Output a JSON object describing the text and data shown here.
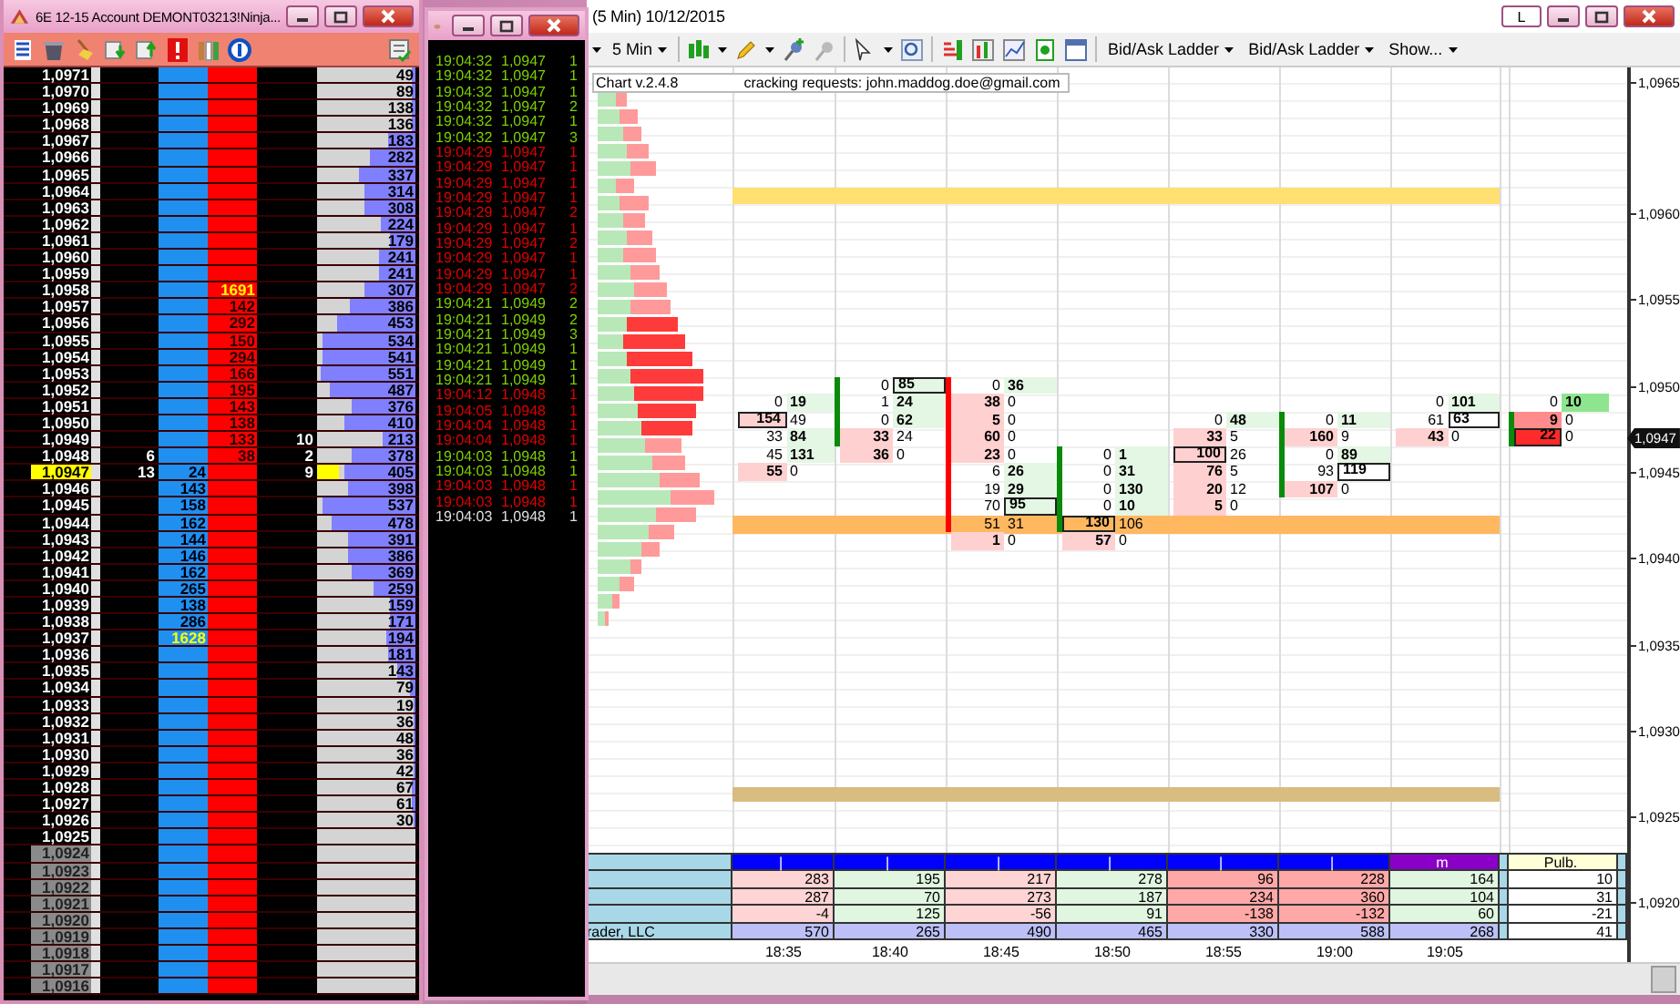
{
  "dom": {
    "title": "6E 12-15  Account DEMONT03213!Ninja...",
    "rows": [
      {
        "price": "1,0971",
        "depth": "49",
        "level": 0.03,
        "current": false,
        "greyed": false
      },
      {
        "price": "1,0970",
        "depth": "89",
        "level": 0.03,
        "current": false,
        "greyed": false
      },
      {
        "price": "1,0969",
        "depth": "138",
        "level": 0.03,
        "current": false,
        "greyed": false
      },
      {
        "price": "1,0968",
        "depth": "136",
        "level": 0.03,
        "current": false,
        "greyed": false
      },
      {
        "price": "1,0967",
        "depth": "183",
        "level": 0.29,
        "current": false,
        "greyed": false
      },
      {
        "price": "1,0966",
        "depth": "282",
        "level": 0.48,
        "current": false,
        "greyed": false
      },
      {
        "price": "1,0965",
        "depth": "337",
        "level": 0.59,
        "current": false,
        "greyed": false
      },
      {
        "price": "1,0964",
        "depth": "314",
        "level": 0.54,
        "current": false,
        "greyed": false
      },
      {
        "price": "1,0963",
        "depth": "308",
        "level": 0.53,
        "current": false,
        "greyed": false
      },
      {
        "price": "1,0962",
        "depth": "224",
        "level": 0.36,
        "current": false,
        "greyed": false
      },
      {
        "price": "1,0961",
        "depth": "179",
        "level": 0.27,
        "current": false,
        "greyed": false
      },
      {
        "price": "1,0960",
        "depth": "241",
        "level": 0.39,
        "current": false,
        "greyed": false
      },
      {
        "price": "1,0959",
        "depth": "241",
        "level": 0.39,
        "current": false,
        "greyed": false
      },
      {
        "price": "1,0958",
        "ask": "1691",
        "depth": "307",
        "level": 0.53,
        "current": false,
        "greyed": false,
        "largest": true
      },
      {
        "price": "1,0957",
        "ask": "142",
        "depth": "386",
        "level": 0.68,
        "current": false,
        "greyed": false,
        "largest": false
      },
      {
        "price": "1,0956",
        "ask": "292",
        "depth": "453",
        "level": 0.83,
        "current": false,
        "greyed": false,
        "largest": false
      },
      {
        "price": "1,0955",
        "ask": "150",
        "depth": "534",
        "level": 0.97,
        "current": false,
        "greyed": false,
        "largest": false
      },
      {
        "price": "1,0954",
        "ask": "294",
        "depth": "541",
        "level": 0.98,
        "current": false,
        "greyed": false,
        "largest": false
      },
      {
        "price": "1,0953",
        "ask": "166",
        "depth": "551",
        "level": 1,
        "current": false,
        "greyed": false,
        "largest": false
      },
      {
        "price": "1,0952",
        "ask": "195",
        "depth": "487",
        "level": 0.9,
        "current": false,
        "greyed": false,
        "largest": false
      },
      {
        "price": "1,0951",
        "ask": "143",
        "depth": "376",
        "level": 0.67,
        "current": false,
        "greyed": false,
        "largest": false
      },
      {
        "price": "1,0950",
        "ask": "138",
        "depth": "410",
        "level": 0.75,
        "current": false,
        "greyed": false,
        "largest": false
      },
      {
        "price": "1,0949",
        "ask": "133",
        "ask_size": "10",
        "depth": "213",
        "level": 0.35,
        "current": false,
        "greyed": false,
        "largest": false
      },
      {
        "price": "1,0948",
        "bid_size": "6",
        "ask": "38",
        "ask_size": "2",
        "depth": "378",
        "level": 0.67,
        "current": false,
        "greyed": false,
        "largest": false
      },
      {
        "price": "1,0947",
        "bid_size": "13",
        "bid": "24",
        "ask_size": "9",
        "depth": "405",
        "level": 0.74,
        "current": true,
        "greyed": false,
        "largest": false
      },
      {
        "price": "1,0946",
        "bid": "143",
        "depth": "398",
        "level": 0.7,
        "current": false,
        "greyed": false,
        "largest": false
      },
      {
        "price": "1,0945",
        "bid": "158",
        "depth": "537",
        "level": 0.97,
        "current": false,
        "greyed": false,
        "largest": false
      },
      {
        "price": "1,0944",
        "bid": "162",
        "depth": "478",
        "level": 0.87,
        "current": false,
        "greyed": false,
        "largest": false
      },
      {
        "price": "1,0943",
        "bid": "144",
        "depth": "391",
        "level": 0.7,
        "current": false,
        "greyed": false,
        "largest": false
      },
      {
        "price": "1,0942",
        "bid": "146",
        "depth": "386",
        "level": 0.7,
        "current": false,
        "greyed": false,
        "largest": false
      },
      {
        "price": "1,0941",
        "bid": "162",
        "depth": "369",
        "level": 0.67,
        "current": false,
        "greyed": false,
        "largest": false
      },
      {
        "price": "1,0940",
        "bid": "265",
        "depth": "259",
        "level": 0.44,
        "current": false,
        "greyed": false,
        "largest": false
      },
      {
        "price": "1,0939",
        "bid": "138",
        "depth": "159",
        "level": 0.26,
        "current": false,
        "greyed": false,
        "largest": false
      },
      {
        "price": "1,0938",
        "bid": "286",
        "depth": "171",
        "level": 0.27,
        "current": false,
        "greyed": false,
        "largest": false
      },
      {
        "price": "1,0937",
        "bid": "1628",
        "depth": "194",
        "level": 0.31,
        "current": false,
        "greyed": false,
        "largest": true
      },
      {
        "price": "1,0936",
        "depth": "181",
        "level": 0.28,
        "current": false,
        "greyed": false
      },
      {
        "price": "1,0935",
        "depth": "143",
        "level": 0.2,
        "current": false,
        "greyed": false
      },
      {
        "price": "1,0934",
        "depth": "79",
        "level": 0.05,
        "current": false,
        "greyed": false
      },
      {
        "price": "1,0933",
        "depth": "19",
        "level": 0.02,
        "current": false,
        "greyed": false
      },
      {
        "price": "1,0932",
        "depth": "36",
        "level": 0.02,
        "current": false,
        "greyed": false
      },
      {
        "price": "1,0931",
        "depth": "48",
        "level": 0.02,
        "current": false,
        "greyed": false
      },
      {
        "price": "1,0930",
        "depth": "36",
        "level": 0.02,
        "current": false,
        "greyed": false
      },
      {
        "price": "1,0929",
        "depth": "42",
        "level": 0.02,
        "current": false,
        "greyed": false
      },
      {
        "price": "1,0928",
        "depth": "67",
        "level": 0.04,
        "current": false,
        "greyed": false
      },
      {
        "price": "1,0927",
        "depth": "61",
        "level": 0.04,
        "current": false,
        "greyed": false
      },
      {
        "price": "1,0926",
        "depth": "30",
        "level": 0.01,
        "current": false,
        "greyed": false
      },
      {
        "price": "1,0925",
        "current": false,
        "greyed": false
      },
      {
        "price": "1,0924",
        "current": false,
        "greyed": true
      },
      {
        "price": "1,0923",
        "current": false,
        "greyed": true
      },
      {
        "price": "1,0922",
        "current": false,
        "greyed": true
      },
      {
        "price": "1,0921",
        "current": false,
        "greyed": true
      },
      {
        "price": "1,0920",
        "current": false,
        "greyed": true
      },
      {
        "price": "1,0919",
        "current": false,
        "greyed": true
      },
      {
        "price": "1,0918",
        "current": false,
        "greyed": true
      },
      {
        "price": "1,0917",
        "current": false,
        "greyed": true
      },
      {
        "price": "1,0916",
        "current": false,
        "greyed": true
      }
    ]
  },
  "time_sales": {
    "rows": [
      {
        "time": "19:04:32",
        "price": "1,0947",
        "size": "1",
        "color": "#7ed000"
      },
      {
        "time": "19:04:32",
        "price": "1,0947",
        "size": "1",
        "color": "#7ed000"
      },
      {
        "time": "19:04:32",
        "price": "1,0947",
        "size": "1",
        "color": "#7ed000"
      },
      {
        "time": "19:04:32",
        "price": "1,0947",
        "size": "2",
        "color": "#7ed000"
      },
      {
        "time": "19:04:32",
        "price": "1,0947",
        "size": "1",
        "color": "#7ed000"
      },
      {
        "time": "19:04:32",
        "price": "1,0947",
        "size": "3",
        "color": "#7ed000"
      },
      {
        "time": "19:04:29",
        "price": "1,0947",
        "size": "1",
        "color": "#e00000"
      },
      {
        "time": "19:04:29",
        "price": "1,0947",
        "size": "1",
        "color": "#e00000"
      },
      {
        "time": "19:04:29",
        "price": "1,0947",
        "size": "1",
        "color": "#e00000"
      },
      {
        "time": "19:04:29",
        "price": "1,0947",
        "size": "1",
        "color": "#e00000"
      },
      {
        "time": "19:04:29",
        "price": "1,0947",
        "size": "2",
        "color": "#e00000"
      },
      {
        "time": "19:04:29",
        "price": "1,0947",
        "size": "1",
        "color": "#e00000"
      },
      {
        "time": "19:04:29",
        "price": "1,0947",
        "size": "2",
        "color": "#e00000"
      },
      {
        "time": "19:04:29",
        "price": "1,0947",
        "size": "1",
        "color": "#e00000"
      },
      {
        "time": "19:04:29",
        "price": "1,0947",
        "size": "1",
        "color": "#e00000"
      },
      {
        "time": "19:04:29",
        "price": "1,0947",
        "size": "2",
        "color": "#e00000"
      },
      {
        "time": "19:04:21",
        "price": "1,0949",
        "size": "2",
        "color": "#7ed000"
      },
      {
        "time": "19:04:21",
        "price": "1,0949",
        "size": "2",
        "color": "#7ed000"
      },
      {
        "time": "19:04:21",
        "price": "1,0949",
        "size": "3",
        "color": "#7ed000"
      },
      {
        "time": "19:04:21",
        "price": "1,0949",
        "size": "1",
        "color": "#7ed000"
      },
      {
        "time": "19:04:21",
        "price": "1,0949",
        "size": "1",
        "color": "#7ed000"
      },
      {
        "time": "19:04:21",
        "price": "1,0949",
        "size": "1",
        "color": "#7ed000"
      },
      {
        "time": "19:04:12",
        "price": "1,0948",
        "size": "1",
        "color": "#e00000"
      },
      {
        "time": "19:04:05",
        "price": "1,0948",
        "size": "1",
        "color": "#e00000"
      },
      {
        "time": "19:04:04",
        "price": "1,0948",
        "size": "1",
        "color": "#e00000"
      },
      {
        "time": "19:04:04",
        "price": "1,0948",
        "size": "1",
        "color": "#e00000"
      },
      {
        "time": "19:04:03",
        "price": "1,0948",
        "size": "1",
        "color": "#7ed000"
      },
      {
        "time": "19:04:03",
        "price": "1,0948",
        "size": "1",
        "color": "#7ed000"
      },
      {
        "time": "19:04:03",
        "price": "1,0948",
        "size": "1",
        "color": "#e00000"
      },
      {
        "time": "19:04:03",
        "price": "1,0948",
        "size": "1",
        "color": "#e00000"
      },
      {
        "time": "19:04:03",
        "price": "1,0948",
        "size": "1",
        "color": "#e0e0e0"
      }
    ]
  },
  "chart": {
    "title": "(5 Min)  10/12/2015",
    "link_button": "L",
    "toolbar": {
      "interval": "5 Min",
      "menus": [
        "Bid/Ask Ladder",
        "Bid/Ask Ladder",
        "Show..."
      ]
    },
    "version": "Chart v.2.4.8",
    "notice": "cracking requests: john.maddog.doe@gmail.com",
    "levels": [
      {
        "color": "#ffe070"
      },
      {
        "color": "#ffb860"
      },
      {
        "color": "#d8bc80"
      }
    ],
    "footprint": [
      {
        "kind": "flat",
        "cells": [
          null,
          {
            "sell": "0",
            "buy": "19",
            "kind": "buy",
            "sell_boxed": false,
            "buy_boxed": false
          },
          {
            "sell": "154",
            "buy": "49",
            "kind": "sell",
            "sell_boxed": true,
            "buy_boxed": false
          },
          {
            "sell": "33",
            "buy": "84",
            "kind": "buy",
            "sell_boxed": false,
            "buy_boxed": false
          },
          {
            "sell": "45",
            "buy": "131",
            "kind": "buy",
            "sell_boxed": false,
            "buy_boxed": false
          },
          {
            "sell": "55",
            "buy": "0",
            "kind": "sell",
            "sell_boxed": false,
            "buy_boxed": false
          }
        ]
      },
      {
        "kind": "up",
        "cells": [
          {
            "sell": "0",
            "buy": "85",
            "kind": "buy",
            "sell_boxed": false,
            "buy_boxed": true,
            "body": true
          },
          {
            "sell": "1",
            "buy": "24",
            "kind": "buy",
            "sell_boxed": false,
            "buy_boxed": false,
            "body": true
          },
          {
            "sell": "0",
            "buy": "62",
            "kind": "buy",
            "sell_boxed": false,
            "buy_boxed": false,
            "body": true
          },
          {
            "sell": "33",
            "buy": "24",
            "kind": "sell",
            "sell_boxed": false,
            "buy_boxed": false,
            "body": true
          },
          {
            "sell": "36",
            "buy": "0",
            "kind": "sell",
            "sell_boxed": false,
            "buy_boxed": false,
            "body": false
          }
        ]
      },
      {
        "kind": "down",
        "cells": [
          {
            "sell": "0",
            "buy": "36",
            "kind": "buy",
            "sell_boxed": false,
            "buy_boxed": false,
            "body": true
          },
          {
            "sell": "38",
            "buy": "0",
            "kind": "sell",
            "sell_boxed": false,
            "buy_boxed": false,
            "body": true
          },
          {
            "sell": "5",
            "buy": "0",
            "kind": "sell",
            "sell_boxed": false,
            "buy_boxed": false,
            "body": true
          },
          {
            "sell": "60",
            "buy": "0",
            "kind": "sell",
            "sell_boxed": false,
            "buy_boxed": false,
            "body": true
          },
          {
            "sell": "23",
            "buy": "0",
            "kind": "sell",
            "sell_boxed": false,
            "buy_boxed": false,
            "body": true
          },
          {
            "sell": "6",
            "buy": "26",
            "kind": "buy",
            "sell_boxed": false,
            "buy_boxed": false,
            "body": true
          },
          {
            "sell": "19",
            "buy": "29",
            "kind": "buy",
            "sell_boxed": false,
            "buy_boxed": false,
            "body": true
          },
          {
            "sell": "70",
            "buy": "95",
            "kind": "buy",
            "sell_boxed": false,
            "buy_boxed": true,
            "body": true
          },
          {
            "sell": "51",
            "buy": "31",
            "kind": "plain",
            "sell_boxed": false,
            "buy_boxed": false,
            "body": true
          },
          {
            "sell": "1",
            "buy": "0",
            "kind": "sell",
            "sell_boxed": false,
            "buy_boxed": false,
            "body": false
          }
        ]
      },
      {
        "kind": "up",
        "cells": [
          null,
          null,
          null,
          null,
          {
            "sell": "0",
            "buy": "1",
            "kind": "buy",
            "sell_boxed": false,
            "buy_boxed": false,
            "body": true
          },
          {
            "sell": "0",
            "buy": "31",
            "kind": "buy",
            "sell_boxed": false,
            "buy_boxed": false,
            "body": true
          },
          {
            "sell": "0",
            "buy": "130",
            "kind": "buy",
            "sell_boxed": false,
            "buy_boxed": false,
            "body": true
          },
          {
            "sell": "0",
            "buy": "10",
            "kind": "buy",
            "sell_boxed": false,
            "buy_boxed": false,
            "body": true
          },
          {
            "sell": "130",
            "buy": "106",
            "kind": "plain",
            "sell_boxed": true,
            "buy_boxed": false,
            "body": true
          },
          {
            "sell": "57",
            "buy": "0",
            "kind": "sell",
            "sell_boxed": false,
            "buy_boxed": false,
            "body": false
          }
        ]
      },
      {
        "kind": "flat",
        "cells": [
          null,
          null,
          {
            "sell": "0",
            "buy": "48",
            "kind": "buy",
            "sell_boxed": false,
            "buy_boxed": false
          },
          {
            "sell": "33",
            "buy": "5",
            "kind": "sell",
            "sell_boxed": false,
            "buy_boxed": false
          },
          {
            "sell": "100",
            "buy": "26",
            "kind": "sell",
            "sell_boxed": true,
            "buy_boxed": false
          },
          {
            "sell": "76",
            "buy": "5",
            "kind": "sell",
            "sell_boxed": false,
            "buy_boxed": false
          },
          {
            "sell": "20",
            "buy": "12",
            "kind": "sell",
            "sell_boxed": false,
            "buy_boxed": false
          },
          {
            "sell": "5",
            "buy": "0",
            "kind": "sell",
            "sell_boxed": false,
            "buy_boxed": false
          }
        ]
      },
      {
        "kind": "up",
        "cells": [
          null,
          null,
          {
            "sell": "0",
            "buy": "11",
            "kind": "buy",
            "sell_boxed": false,
            "buy_boxed": false,
            "body": true
          },
          {
            "sell": "160",
            "buy": "9",
            "kind": "sell",
            "sell_boxed": false,
            "buy_boxed": false,
            "body": true
          },
          {
            "sell": "0",
            "buy": "89",
            "kind": "buy",
            "sell_boxed": false,
            "buy_boxed": false,
            "body": true
          },
          {
            "sell": "93",
            "buy": "119",
            "kind": "plain",
            "sell_boxed": false,
            "buy_boxed": true,
            "body": true
          },
          {
            "sell": "107",
            "buy": "0",
            "kind": "sell",
            "sell_boxed": false,
            "buy_boxed": false,
            "body": true
          }
        ]
      },
      {
        "kind": "flat",
        "cells": [
          null,
          {
            "sell": "0",
            "buy": "101",
            "kind": "buy",
            "sell_boxed": false,
            "buy_boxed": false
          },
          {
            "sell": "61",
            "buy": "63",
            "kind": "plain",
            "sell_boxed": false,
            "buy_boxed": true
          },
          {
            "sell": "43",
            "buy": "0",
            "kind": "sell",
            "sell_boxed": false,
            "buy_boxed": false
          }
        ]
      },
      {
        "kind": "up",
        "cells": [
          null,
          {
            "sell": "0",
            "buy": "10",
            "kind": "strong_buy",
            "sell_boxed": false,
            "buy_boxed": false,
            "body": false
          },
          {
            "sell": "9",
            "buy": "0",
            "kind": "medium_sell",
            "sell_boxed": false,
            "buy_boxed": false,
            "body": true
          },
          {
            "sell": "22",
            "buy": "0",
            "kind": "strong_sell",
            "sell_boxed": true,
            "buy_boxed": false,
            "body": true
          }
        ]
      }
    ],
    "price_axis": {
      "labels": [
        "1,0965",
        "1,0960",
        "1,0955",
        "1,0950",
        "1,0945",
        "1,0940",
        "1,0935",
        "1,0930",
        "1,0925",
        "1,0920"
      ],
      "current": "1,0947"
    },
    "summary": {
      "header": [
        {
          "label": "|",
          "color": "#0000ff"
        },
        {
          "label": "|",
          "color": "#0000ff"
        },
        {
          "label": "|",
          "color": "#0000ff"
        },
        {
          "label": "|",
          "color": "#0000ff"
        },
        {
          "label": "|",
          "color": "#0000ff"
        },
        {
          "label": "|",
          "color": "#0000ff"
        },
        {
          "label": "m",
          "color": "#8a00c8"
        }
      ],
      "extra_header": "Pulb.",
      "rows": [
        {
          "cells": [
            {
              "value": "283",
              "kind": "sell"
            },
            {
              "value": "195",
              "kind": "buy"
            },
            {
              "value": "217",
              "kind": "sell"
            },
            {
              "value": "278",
              "kind": "buy"
            },
            {
              "value": "96",
              "kind": "strong_sell"
            },
            {
              "value": "228",
              "kind": "strong_sell"
            },
            {
              "value": "164",
              "kind": "buy"
            }
          ],
          "extra": "10"
        },
        {
          "cells": [
            {
              "value": "287",
              "kind": "sell"
            },
            {
              "value": "70",
              "kind": "buy"
            },
            {
              "value": "273",
              "kind": "sell"
            },
            {
              "value": "187",
              "kind": "buy"
            },
            {
              "value": "234",
              "kind": "strong_sell"
            },
            {
              "value": "360",
              "kind": "strong_sell"
            },
            {
              "value": "104",
              "kind": "buy"
            }
          ],
          "extra": "31"
        },
        {
          "cells": [
            {
              "value": "-4",
              "kind": "sell"
            },
            {
              "value": "125",
              "kind": "buy"
            },
            {
              "value": "-56",
              "kind": "sell"
            },
            {
              "value": "91",
              "kind": "buy"
            },
            {
              "value": "-138",
              "kind": "strong_sell"
            },
            {
              "value": "-132",
              "kind": "strong_sell"
            },
            {
              "value": "60",
              "kind": "buy"
            }
          ],
          "extra": "-21"
        },
        {
          "label": "rader, LLC",
          "cells": [
            {
              "value": "570",
              "kind": "total"
            },
            {
              "value": "265",
              "kind": "total"
            },
            {
              "value": "490",
              "kind": "total"
            },
            {
              "value": "465",
              "kind": "total"
            },
            {
              "value": "330",
              "kind": "total"
            },
            {
              "value": "588",
              "kind": "total"
            },
            {
              "value": "268",
              "kind": "total"
            }
          ],
          "extra": "41"
        }
      ]
    },
    "time_labels": [
      "18:35",
      "18:40",
      "18:45",
      "18:50",
      "18:55",
      "19:00",
      "19:05"
    ]
  }
}
